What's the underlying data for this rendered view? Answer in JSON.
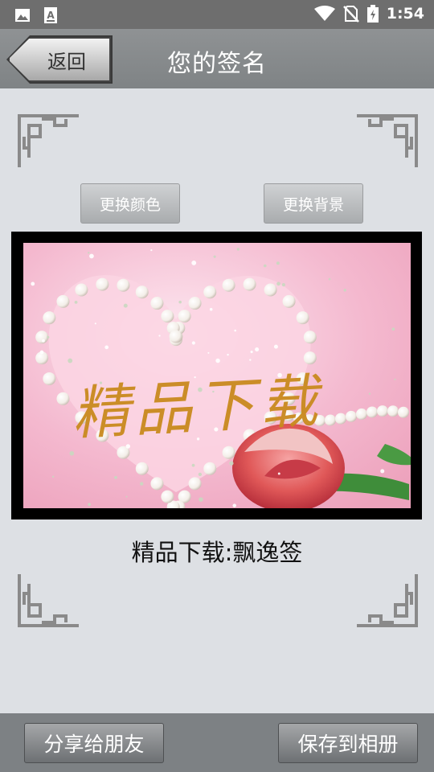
{
  "status_bar": {
    "time": "1:54",
    "icons": [
      "image-icon",
      "text-a-icon",
      "wifi-icon",
      "no-sim-icon",
      "battery-icon"
    ]
  },
  "header": {
    "back_label": "返回",
    "title": "您的签名"
  },
  "toolbar": {
    "change_color_label": "更换颜色",
    "change_background_label": "更换背景"
  },
  "canvas": {
    "signature_text": "精品下载",
    "signature_color": "#c98a1e",
    "background_theme": "pink-heart-pearls-rose"
  },
  "signature_caption": "精品下载:飘逸签",
  "footer": {
    "share_label": "分享给朋友",
    "save_label": "保存到相册"
  },
  "colors": {
    "status_bar": "#6e6e6e",
    "title_bar": "#888b8d",
    "page_bg": "#dde0e4",
    "bottom_bar": "#7d8184"
  }
}
